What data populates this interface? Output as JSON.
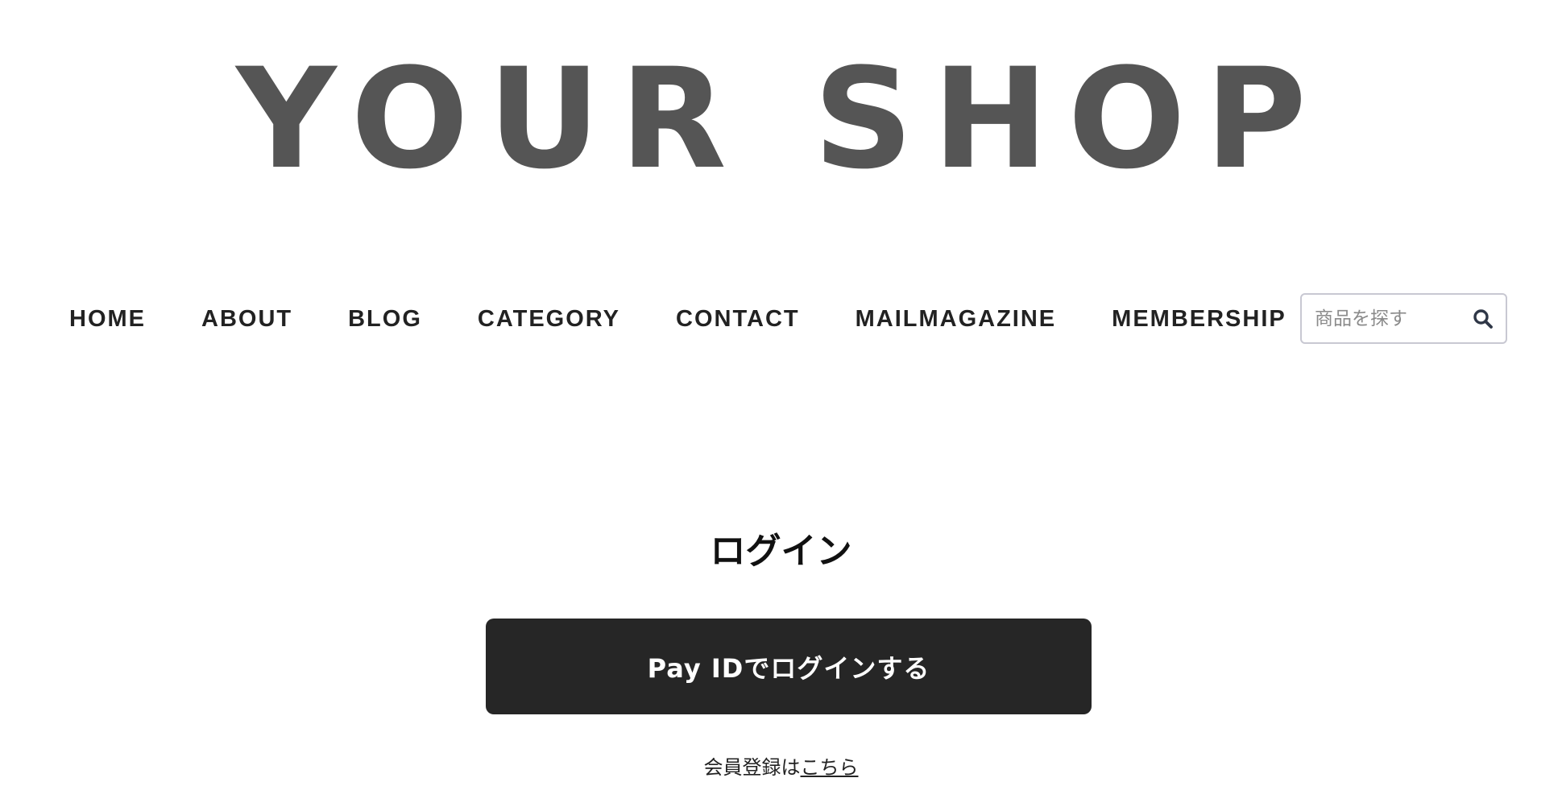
{
  "header": {
    "logo_text": "YOUR SHOP"
  },
  "nav": {
    "items": [
      {
        "label": "HOME"
      },
      {
        "label": "ABOUT"
      },
      {
        "label": "BLOG"
      },
      {
        "label": "CATEGORY"
      },
      {
        "label": "CONTACT"
      },
      {
        "label": "MAILMAGAZINE"
      },
      {
        "label": "MEMBERSHIP"
      }
    ]
  },
  "search": {
    "placeholder": "商品を探す",
    "value": "",
    "icon": "search-icon"
  },
  "login": {
    "title": "ログイン",
    "payid_button_label": "Pay IDでログインする",
    "register_prefix": "会員登録は",
    "register_link_label": "こちら"
  },
  "colors": {
    "logo": "#555555",
    "button_bg": "#262626",
    "button_text": "#ffffff",
    "search_border": "#c8c8d2",
    "icon": "#2f3747"
  }
}
